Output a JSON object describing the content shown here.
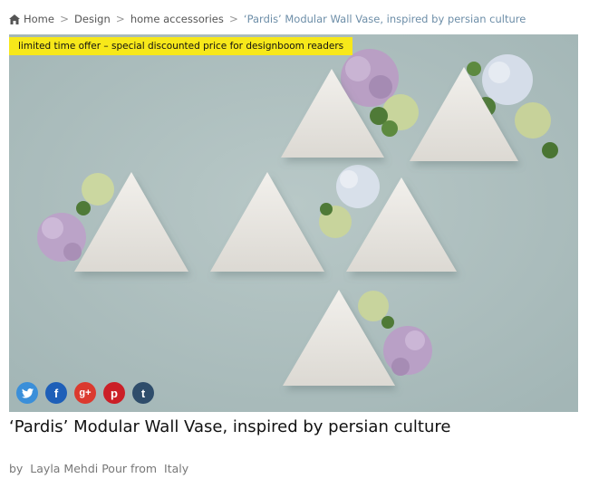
{
  "breadcrumb": {
    "items": [
      {
        "label": "Home"
      },
      {
        "label": "Design"
      },
      {
        "label": "home accessories"
      },
      {
        "label": "‘Pardis’ Modular Wall Vase, inspired by persian culture"
      }
    ],
    "separator": ">"
  },
  "offer_banner": "limited time offer – special discounted price for designboom readers",
  "social": [
    {
      "icon": "twitter-icon",
      "glyph": "t",
      "color": "#3b8fd9"
    },
    {
      "icon": "facebook-icon",
      "glyph": "f",
      "color": "#1e5fb8"
    },
    {
      "icon": "google-plus-icon",
      "glyph": "g+",
      "color": "#db3a2f"
    },
    {
      "icon": "pinterest-icon",
      "glyph": "p",
      "color": "#cb1f27"
    },
    {
      "icon": "tumblr-icon",
      "glyph": "t",
      "color": "#2f4d6b"
    }
  ],
  "article": {
    "title": "‘Pardis’ Modular Wall Vase, inspired by persian culture",
    "byline_prefix": "by",
    "author": "Layla Mehdi Pour",
    "from_word": "from",
    "country": "Italy"
  },
  "colors": {
    "hero_background": "#a9bcbc",
    "banner": "#f7e81a",
    "link_current": "#6d8ea8"
  }
}
